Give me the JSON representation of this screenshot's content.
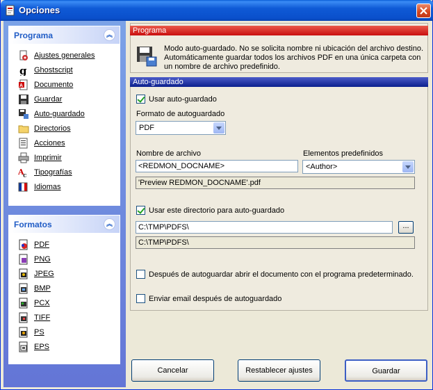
{
  "window": {
    "title": "Opciones"
  },
  "programa": {
    "title": "Programa",
    "items": [
      {
        "label": "Ajustes generales",
        "icon": "settings-icon"
      },
      {
        "label": "Ghostscript",
        "icon": "ghostscript-icon"
      },
      {
        "label": "Documento",
        "icon": "document-icon"
      },
      {
        "label": "Guardar",
        "icon": "floppy-icon"
      },
      {
        "label": "Auto-guardado",
        "icon": "autosave-icon"
      },
      {
        "label": "Directorios",
        "icon": "folder-icon"
      },
      {
        "label": "Acciones",
        "icon": "actions-icon"
      },
      {
        "label": "Imprimir",
        "icon": "printer-icon"
      },
      {
        "label": "Tipografías",
        "icon": "fonts-icon"
      },
      {
        "label": "Idiomas",
        "icon": "languages-icon"
      }
    ]
  },
  "formatos": {
    "title": "Formatos",
    "items": [
      {
        "label": "PDF"
      },
      {
        "label": "PNG"
      },
      {
        "label": "JPEG"
      },
      {
        "label": "BMP"
      },
      {
        "label": "PCX"
      },
      {
        "label": "TIFF"
      },
      {
        "label": "PS"
      },
      {
        "label": "EPS"
      }
    ]
  },
  "programa_section": {
    "header": "Programa",
    "description": "Modo auto-guardado. No se solicita nombre ni ubicación del archivo destino. Automáticamente guardar todos los archivos PDF en una única carpeta con un nombre de archivo predefinido."
  },
  "autosave": {
    "header": "Auto-guardado",
    "use_autosave": "Usar auto-guardado",
    "format_label": "Formato de autoguardado",
    "format_value": "PDF",
    "filename_label": "Nombre de archivo",
    "filename_value": "<REDMON_DOCNAME>",
    "tokens_label": "Elementos predefinidos",
    "tokens_value": "<Author>",
    "filename_preview": "'Preview REDMON_DOCNAME'.pdf",
    "use_dir": "Usar este directorio para auto-guardado",
    "dir_value": "C:\\TMP\\PDFS\\",
    "dir_preview": "C:\\TMP\\PDFS\\",
    "browse_label": "...",
    "open_after": "Después de autoguardar abrir el documento con el programa predeterminado.",
    "send_email": "Enviar email después de autoguardado"
  },
  "buttons": {
    "cancel": "Cancelar",
    "reset": "Restablecer ajustes",
    "save": "Guardar"
  }
}
